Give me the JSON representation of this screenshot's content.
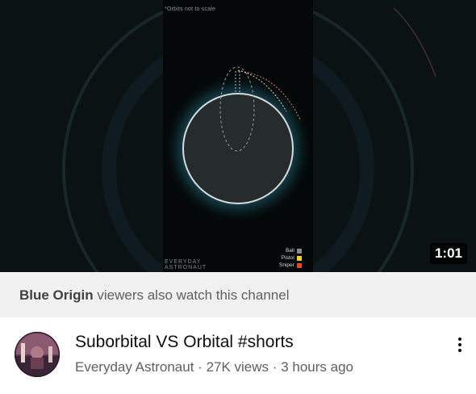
{
  "video": {
    "duration": "1:01",
    "thumbnail": {
      "note": "*Orbits not to scale",
      "brand_line1": "EVERYDAY",
      "brand_line2": "ASTRONAUT",
      "legend": [
        {
          "label": "Ball",
          "color": "#8a8a8a"
        },
        {
          "label": "Pistol",
          "color": "#f2d21b"
        },
        {
          "label": "Sniper",
          "color": "#e0482a"
        }
      ]
    },
    "title": "Suborbital VS Orbital #shorts",
    "channel": "Everyday Astronaut",
    "views": "27K views",
    "age": "3 hours ago",
    "separator": "·"
  },
  "banner": {
    "channel_name": "Blue Origin",
    "suffix": "viewers also watch this channel"
  },
  "menu": {
    "icon": "more-vert-icon"
  }
}
